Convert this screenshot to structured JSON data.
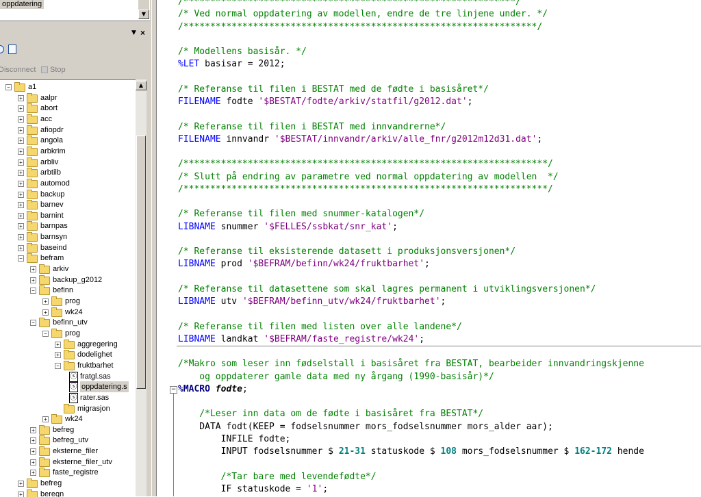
{
  "explorer": {
    "selected_top_item": "oppdatering",
    "toolbar": {
      "disconnect": "Disconnect",
      "stop": "Stop"
    },
    "tree": [
      {
        "label": "a1",
        "level": 0,
        "expanded": true
      },
      {
        "label": "aalpr",
        "level": 1,
        "expanded": false
      },
      {
        "label": "abort",
        "level": 1,
        "expanded": false
      },
      {
        "label": "acc",
        "level": 1,
        "expanded": false
      },
      {
        "label": "afiopdr",
        "level": 1,
        "expanded": false
      },
      {
        "label": "angola",
        "level": 1,
        "expanded": false
      },
      {
        "label": "arbkrim",
        "level": 1,
        "expanded": false
      },
      {
        "label": "arbliv",
        "level": 1,
        "expanded": false
      },
      {
        "label": "arbtilb",
        "level": 1,
        "expanded": false
      },
      {
        "label": "automod",
        "level": 1,
        "expanded": false
      },
      {
        "label": "backup",
        "level": 1,
        "expanded": false
      },
      {
        "label": "barnev",
        "level": 1,
        "expanded": false
      },
      {
        "label": "barnint",
        "level": 1,
        "expanded": false
      },
      {
        "label": "barnpas",
        "level": 1,
        "expanded": false
      },
      {
        "label": "barnsyn",
        "level": 1,
        "expanded": false
      },
      {
        "label": "baseind",
        "level": 1,
        "expanded": false
      },
      {
        "label": "befram",
        "level": 1,
        "expanded": true
      },
      {
        "label": "arkiv",
        "level": 2,
        "expanded": false
      },
      {
        "label": "backup_g2012",
        "level": 2,
        "expanded": false
      },
      {
        "label": "befinn",
        "level": 2,
        "expanded": true
      },
      {
        "label": "prog",
        "level": 3,
        "expanded": false
      },
      {
        "label": "wk24",
        "level": 3,
        "expanded": false
      },
      {
        "label": "befinn_utv",
        "level": 2,
        "expanded": true
      },
      {
        "label": "prog",
        "level": 3,
        "expanded": true
      },
      {
        "label": "aggregering",
        "level": 4,
        "expanded": false
      },
      {
        "label": "dodelighet",
        "level": 4,
        "expanded": false
      },
      {
        "label": "fruktbarhet",
        "level": 4,
        "expanded": true
      },
      {
        "label": "fratgl.sas",
        "level": 5,
        "type": "file"
      },
      {
        "label": "oppdatering.s",
        "level": 5,
        "type": "file",
        "selected": true
      },
      {
        "label": "rater.sas",
        "level": 5,
        "type": "file"
      },
      {
        "label": "migrasjon",
        "level": 4,
        "type": "folder-only"
      },
      {
        "label": "wk24",
        "level": 3,
        "expanded": false
      },
      {
        "label": "befreg",
        "level": 2,
        "expanded": false
      },
      {
        "label": "befreg_utv",
        "level": 2,
        "expanded": false
      },
      {
        "label": "eksterne_filer",
        "level": 2,
        "expanded": false
      },
      {
        "label": "eksterne_filer_utv",
        "level": 2,
        "expanded": false
      },
      {
        "label": "faste_registre",
        "level": 2,
        "expanded": false
      },
      {
        "label": "befreg",
        "level": 1,
        "expanded": false
      },
      {
        "label": "beregn",
        "level": 1,
        "expanded": false
      }
    ]
  },
  "code_lines": [
    [
      {
        "t": "c",
        "v": "/**************************************************************/"
      }
    ],
    [
      {
        "t": "c",
        "v": "/* Ved normal oppdatering av modellen, endre de tre linjene under. */"
      }
    ],
    [
      {
        "t": "c",
        "v": "/******************************************************************/"
      }
    ],
    [],
    [
      {
        "t": "c",
        "v": "/* Modellens basisår. */"
      }
    ],
    [
      {
        "t": "k",
        "v": "%LET"
      },
      {
        "t": "p",
        "v": " basisar = 2012;"
      }
    ],
    [],
    [
      {
        "t": "c",
        "v": "/* Referanse til filen i BESTAT med de fødte i basisåret*/"
      }
    ],
    [
      {
        "t": "k",
        "v": "FILENAME"
      },
      {
        "t": "p",
        "v": " fodte "
      },
      {
        "t": "s",
        "v": "'$BESTAT/fodte/arkiv/statfil/g2012.dat'"
      },
      {
        "t": "p",
        "v": ";"
      }
    ],
    [],
    [
      {
        "t": "c",
        "v": "/* Referanse til filen i BESTAT med innvandrerne*/"
      }
    ],
    [
      {
        "t": "k",
        "v": "FILENAME"
      },
      {
        "t": "p",
        "v": " innvandr "
      },
      {
        "t": "s",
        "v": "'$BESTAT/innvandr/arkiv/alle_fnr/g2012m12d31.dat'"
      },
      {
        "t": "p",
        "v": ";"
      }
    ],
    [],
    [
      {
        "t": "c",
        "v": "/********************************************************************/"
      }
    ],
    [
      {
        "t": "c",
        "v": "/* Slutt på endring av parametre ved normal oppdatering av modellen  */"
      }
    ],
    [
      {
        "t": "c",
        "v": "/********************************************************************/"
      }
    ],
    [],
    [
      {
        "t": "c",
        "v": "/* Referanse til filen med snummer-katalogen*/"
      }
    ],
    [
      {
        "t": "k",
        "v": "LIBNAME"
      },
      {
        "t": "p",
        "v": " snummer "
      },
      {
        "t": "s",
        "v": "'$FELLES/ssbkat/snr_kat'"
      },
      {
        "t": "p",
        "v": ";"
      }
    ],
    [],
    [
      {
        "t": "c",
        "v": "/* Referanse til eksisterende datasett i produksjonsversjonen*/"
      }
    ],
    [
      {
        "t": "k",
        "v": "LIBNAME"
      },
      {
        "t": "p",
        "v": " prod "
      },
      {
        "t": "s",
        "v": "'$BEFRAM/befinn/wk24/fruktbarhet'"
      },
      {
        "t": "p",
        "v": ";"
      }
    ],
    [],
    [
      {
        "t": "c",
        "v": "/* Referanse til datasettene som skal lagres permanent i utviklingsversjonen*/"
      }
    ],
    [
      {
        "t": "k",
        "v": "LIBNAME"
      },
      {
        "t": "p",
        "v": " utv "
      },
      {
        "t": "s",
        "v": "'$BEFRAM/befinn_utv/wk24/fruktbarhet'"
      },
      {
        "t": "p",
        "v": ";"
      }
    ],
    [],
    [
      {
        "t": "c",
        "v": "/* Referanse til filen med listen over alle landene*/"
      }
    ],
    [
      {
        "t": "k",
        "v": "LIBNAME"
      },
      {
        "t": "p",
        "v": " landkat "
      },
      {
        "t": "s",
        "v": "'$BEFRAM/faste_registre/wk24'"
      },
      {
        "t": "p",
        "v": ";"
      }
    ],
    [],
    [
      {
        "t": "c",
        "v": "/*Makro som leser inn fødselstall i basisåret fra BESTAT, bearbeider innvandringskjenne"
      }
    ],
    [
      {
        "t": "c",
        "v": "    og oppdaterer gamle data med ny årgang (1990-basisår)*/"
      }
    ],
    [
      {
        "t": "b",
        "v": "%MACRO"
      },
      {
        "t": "p",
        "v": " "
      },
      {
        "t": "m",
        "v": "fodte"
      },
      {
        "t": "p",
        "v": ";"
      }
    ],
    [],
    [
      {
        "t": "c",
        "v": "    /*Leser inn data om de fødte i basisåret fra BESTAT*/"
      }
    ],
    [
      {
        "t": "p",
        "v": "    DATA fodt(KEEP = fodselsnummer mors_fodselsnummer mors_alder aar);"
      }
    ],
    [
      {
        "t": "p",
        "v": "        INFILE fodte;"
      }
    ],
    [
      {
        "t": "p",
        "v": "        INPUT fodselsnummer $ "
      },
      {
        "t": "n",
        "v": "21-31"
      },
      {
        "t": "p",
        "v": " statuskode $ "
      },
      {
        "t": "n",
        "v": "108"
      },
      {
        "t": "p",
        "v": " mors_fodselsnummer $ "
      },
      {
        "t": "n",
        "v": "162-172"
      },
      {
        "t": "p",
        "v": " hende"
      }
    ],
    [],
    [
      {
        "t": "c",
        "v": "        /*Tar bare med levendefødte*/"
      }
    ],
    [
      {
        "t": "p",
        "v": "        IF statuskode = "
      },
      {
        "t": "s",
        "v": "'1'"
      },
      {
        "t": "p",
        "v": ";"
      }
    ]
  ]
}
